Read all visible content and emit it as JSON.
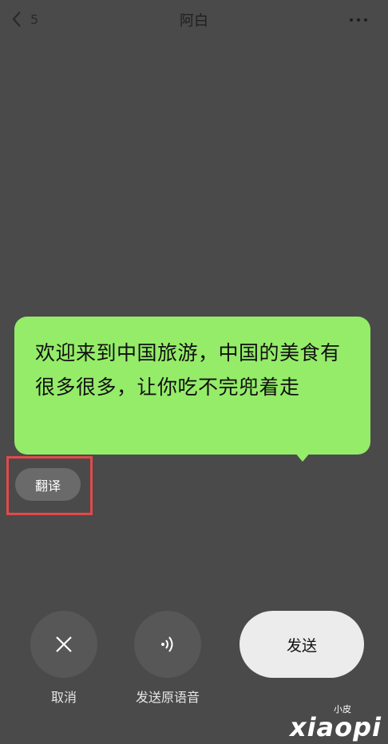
{
  "header": {
    "unread_count": "5",
    "title": "阿白"
  },
  "message": {
    "text": "欢迎来到中国旅游，中国的美食有很多很多，让你吃不完兜着走"
  },
  "translate": {
    "label": "翻译"
  },
  "actions": {
    "cancel_label": "取消",
    "send_voice_label": "发送原语音",
    "send_label": "发送"
  },
  "watermark": {
    "small": "小皮",
    "big": "xiaopi"
  },
  "colors": {
    "bubble": "#95ec69",
    "background": "#4a4a4a",
    "highlight": "#e24a4a"
  }
}
